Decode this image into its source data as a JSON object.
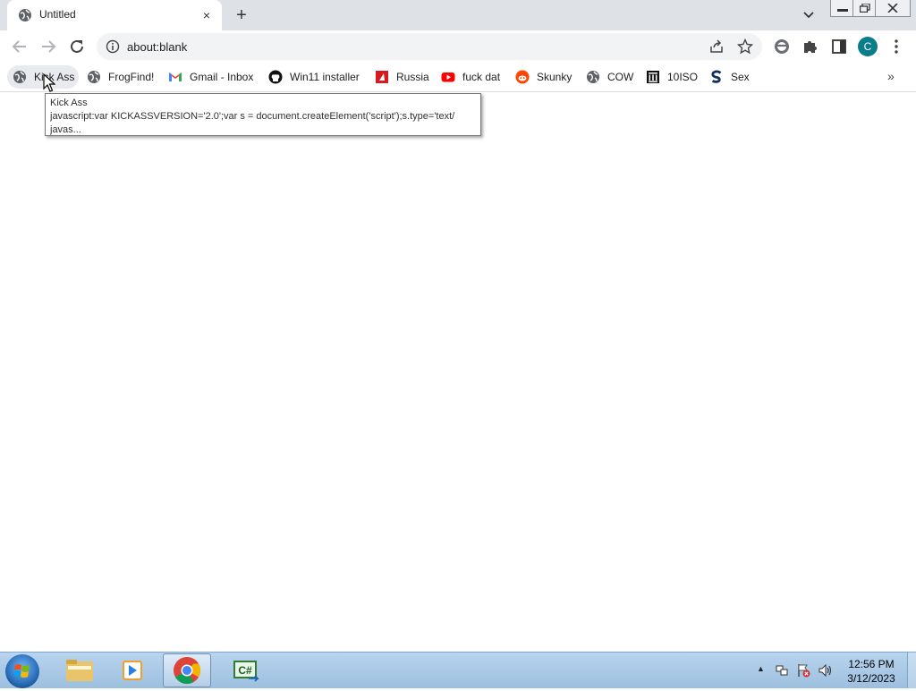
{
  "tab": {
    "title": "Untitled",
    "close": "×",
    "new_tab": "+"
  },
  "address": {
    "url_prefix": "about:",
    "url_rest": "blank"
  },
  "profile": {
    "initial": "C"
  },
  "bookmarks": [
    {
      "label": "Kick Ass",
      "icon": "globe-icon"
    },
    {
      "label": "FrogFind!",
      "icon": "globe-icon"
    },
    {
      "label": "Gmail - Inbox",
      "icon": "gmail-icon"
    },
    {
      "label": "Win11 installer",
      "icon": "github-icon"
    },
    {
      "label": "Russia",
      "icon": "red-square-icon"
    },
    {
      "label": "fuck dat",
      "icon": "youtube-icon"
    },
    {
      "label": "Skunky",
      "icon": "reddit-icon"
    },
    {
      "label": "COW",
      "icon": "globe-icon"
    },
    {
      "label": "10ISO",
      "icon": "building-icon"
    },
    {
      "label": "Sex",
      "icon": "s-logo-icon"
    }
  ],
  "bookmarks_overflow": "»",
  "tooltip": {
    "line1": "Kick Ass",
    "line2": "javascript:var KICKASSVERSION='2.0';var s = document.createElement('script');s.type='text/",
    "line3": "javas..."
  },
  "taskbar": {
    "time": "12:56 PM",
    "date": "3/12/2023",
    "tray_arrow": "▲"
  },
  "colors": {
    "profile": "#0a7d8a",
    "youtube": "#ff0000",
    "reddit": "#ff4500",
    "accent": "#1a73e8"
  }
}
